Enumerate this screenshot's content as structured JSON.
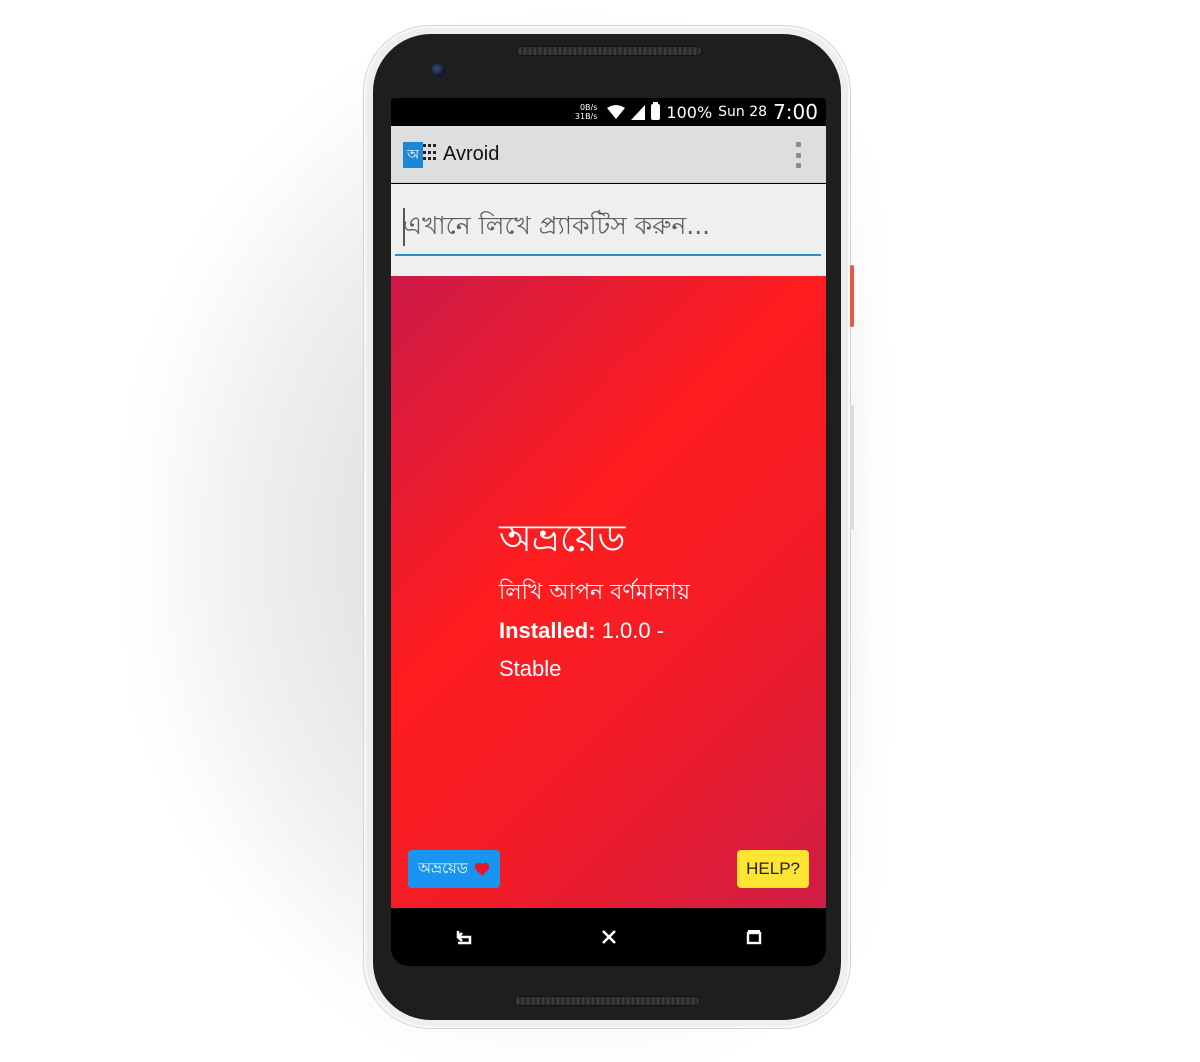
{
  "status_bar": {
    "net_down": "0B/s",
    "net_up": "31B/s",
    "battery": "100%",
    "date": "Sun 28",
    "time": "7:00"
  },
  "app_bar": {
    "logo_glyph": "অ",
    "title": "Avroid",
    "menu_icon": "overflow-menu-icon"
  },
  "input": {
    "placeholder": "এখানে লিখে প্র্যাকটিস করুন..."
  },
  "hero": {
    "title": "অভ্রয়েড",
    "tagline": "লিখি আপন বর্ণমালায়",
    "installed_label": "Installed:",
    "installed_value": "1.0.0 - Stable",
    "colors": {
      "from": "#cc1a48",
      "mid": "#ff1d1f",
      "to": "#cf1d44"
    }
  },
  "buttons": {
    "badge_label": "অভ্রয়েড",
    "badge_icon": "heart-icon",
    "help_label": "HELP?"
  },
  "nav": {
    "icons": [
      "back-icon",
      "close-icon",
      "recents-icon"
    ]
  }
}
